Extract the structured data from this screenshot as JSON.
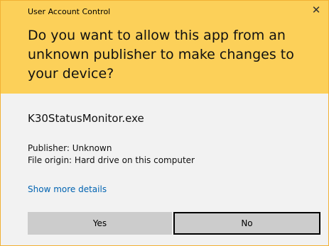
{
  "window": {
    "title": "User Account Control",
    "close_glyph": "✕"
  },
  "prompt": {
    "question": "Do you want to allow this app from an unknown publisher to make changes to your device?"
  },
  "app": {
    "name": "K30StatusMonitor.exe",
    "publisher": "Publisher: Unknown",
    "file_origin": "File origin: Hard drive on this computer"
  },
  "links": {
    "show_more": "Show more details"
  },
  "buttons": {
    "yes": "Yes",
    "no": "No"
  },
  "colors": {
    "header_bg": "#fcd059",
    "body_bg": "#f2f2f2",
    "link": "#0063b1",
    "button_bg": "#cccccc"
  },
  "icons": {
    "close": "close-icon"
  }
}
